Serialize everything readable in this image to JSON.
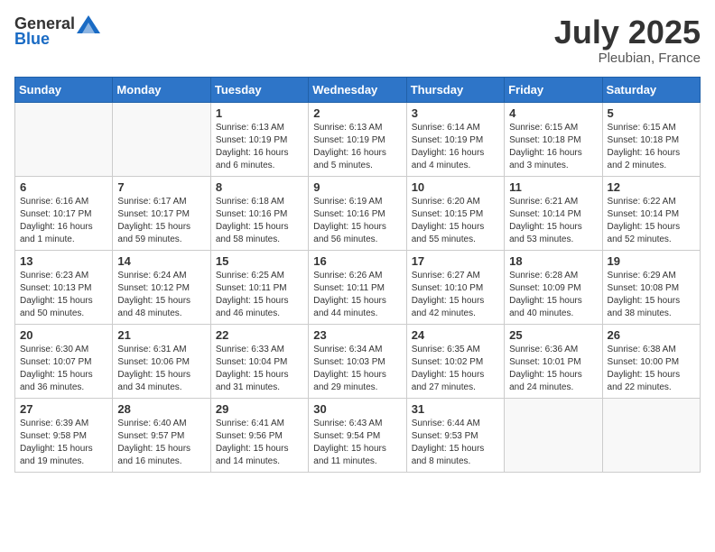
{
  "logo": {
    "general": "General",
    "blue": "Blue"
  },
  "title": "July 2025",
  "location": "Pleubian, France",
  "days_of_week": [
    "Sunday",
    "Monday",
    "Tuesday",
    "Wednesday",
    "Thursday",
    "Friday",
    "Saturday"
  ],
  "weeks": [
    [
      {
        "day": "",
        "info": ""
      },
      {
        "day": "",
        "info": ""
      },
      {
        "day": "1",
        "info": "Sunrise: 6:13 AM\nSunset: 10:19 PM\nDaylight: 16 hours and 6 minutes."
      },
      {
        "day": "2",
        "info": "Sunrise: 6:13 AM\nSunset: 10:19 PM\nDaylight: 16 hours and 5 minutes."
      },
      {
        "day": "3",
        "info": "Sunrise: 6:14 AM\nSunset: 10:19 PM\nDaylight: 16 hours and 4 minutes."
      },
      {
        "day": "4",
        "info": "Sunrise: 6:15 AM\nSunset: 10:18 PM\nDaylight: 16 hours and 3 minutes."
      },
      {
        "day": "5",
        "info": "Sunrise: 6:15 AM\nSunset: 10:18 PM\nDaylight: 16 hours and 2 minutes."
      }
    ],
    [
      {
        "day": "6",
        "info": "Sunrise: 6:16 AM\nSunset: 10:17 PM\nDaylight: 16 hours and 1 minute."
      },
      {
        "day": "7",
        "info": "Sunrise: 6:17 AM\nSunset: 10:17 PM\nDaylight: 15 hours and 59 minutes."
      },
      {
        "day": "8",
        "info": "Sunrise: 6:18 AM\nSunset: 10:16 PM\nDaylight: 15 hours and 58 minutes."
      },
      {
        "day": "9",
        "info": "Sunrise: 6:19 AM\nSunset: 10:16 PM\nDaylight: 15 hours and 56 minutes."
      },
      {
        "day": "10",
        "info": "Sunrise: 6:20 AM\nSunset: 10:15 PM\nDaylight: 15 hours and 55 minutes."
      },
      {
        "day": "11",
        "info": "Sunrise: 6:21 AM\nSunset: 10:14 PM\nDaylight: 15 hours and 53 minutes."
      },
      {
        "day": "12",
        "info": "Sunrise: 6:22 AM\nSunset: 10:14 PM\nDaylight: 15 hours and 52 minutes."
      }
    ],
    [
      {
        "day": "13",
        "info": "Sunrise: 6:23 AM\nSunset: 10:13 PM\nDaylight: 15 hours and 50 minutes."
      },
      {
        "day": "14",
        "info": "Sunrise: 6:24 AM\nSunset: 10:12 PM\nDaylight: 15 hours and 48 minutes."
      },
      {
        "day": "15",
        "info": "Sunrise: 6:25 AM\nSunset: 10:11 PM\nDaylight: 15 hours and 46 minutes."
      },
      {
        "day": "16",
        "info": "Sunrise: 6:26 AM\nSunset: 10:11 PM\nDaylight: 15 hours and 44 minutes."
      },
      {
        "day": "17",
        "info": "Sunrise: 6:27 AM\nSunset: 10:10 PM\nDaylight: 15 hours and 42 minutes."
      },
      {
        "day": "18",
        "info": "Sunrise: 6:28 AM\nSunset: 10:09 PM\nDaylight: 15 hours and 40 minutes."
      },
      {
        "day": "19",
        "info": "Sunrise: 6:29 AM\nSunset: 10:08 PM\nDaylight: 15 hours and 38 minutes."
      }
    ],
    [
      {
        "day": "20",
        "info": "Sunrise: 6:30 AM\nSunset: 10:07 PM\nDaylight: 15 hours and 36 minutes."
      },
      {
        "day": "21",
        "info": "Sunrise: 6:31 AM\nSunset: 10:06 PM\nDaylight: 15 hours and 34 minutes."
      },
      {
        "day": "22",
        "info": "Sunrise: 6:33 AM\nSunset: 10:04 PM\nDaylight: 15 hours and 31 minutes."
      },
      {
        "day": "23",
        "info": "Sunrise: 6:34 AM\nSunset: 10:03 PM\nDaylight: 15 hours and 29 minutes."
      },
      {
        "day": "24",
        "info": "Sunrise: 6:35 AM\nSunset: 10:02 PM\nDaylight: 15 hours and 27 minutes."
      },
      {
        "day": "25",
        "info": "Sunrise: 6:36 AM\nSunset: 10:01 PM\nDaylight: 15 hours and 24 minutes."
      },
      {
        "day": "26",
        "info": "Sunrise: 6:38 AM\nSunset: 10:00 PM\nDaylight: 15 hours and 22 minutes."
      }
    ],
    [
      {
        "day": "27",
        "info": "Sunrise: 6:39 AM\nSunset: 9:58 PM\nDaylight: 15 hours and 19 minutes."
      },
      {
        "day": "28",
        "info": "Sunrise: 6:40 AM\nSunset: 9:57 PM\nDaylight: 15 hours and 16 minutes."
      },
      {
        "day": "29",
        "info": "Sunrise: 6:41 AM\nSunset: 9:56 PM\nDaylight: 15 hours and 14 minutes."
      },
      {
        "day": "30",
        "info": "Sunrise: 6:43 AM\nSunset: 9:54 PM\nDaylight: 15 hours and 11 minutes."
      },
      {
        "day": "31",
        "info": "Sunrise: 6:44 AM\nSunset: 9:53 PM\nDaylight: 15 hours and 8 minutes."
      },
      {
        "day": "",
        "info": ""
      },
      {
        "day": "",
        "info": ""
      }
    ]
  ]
}
